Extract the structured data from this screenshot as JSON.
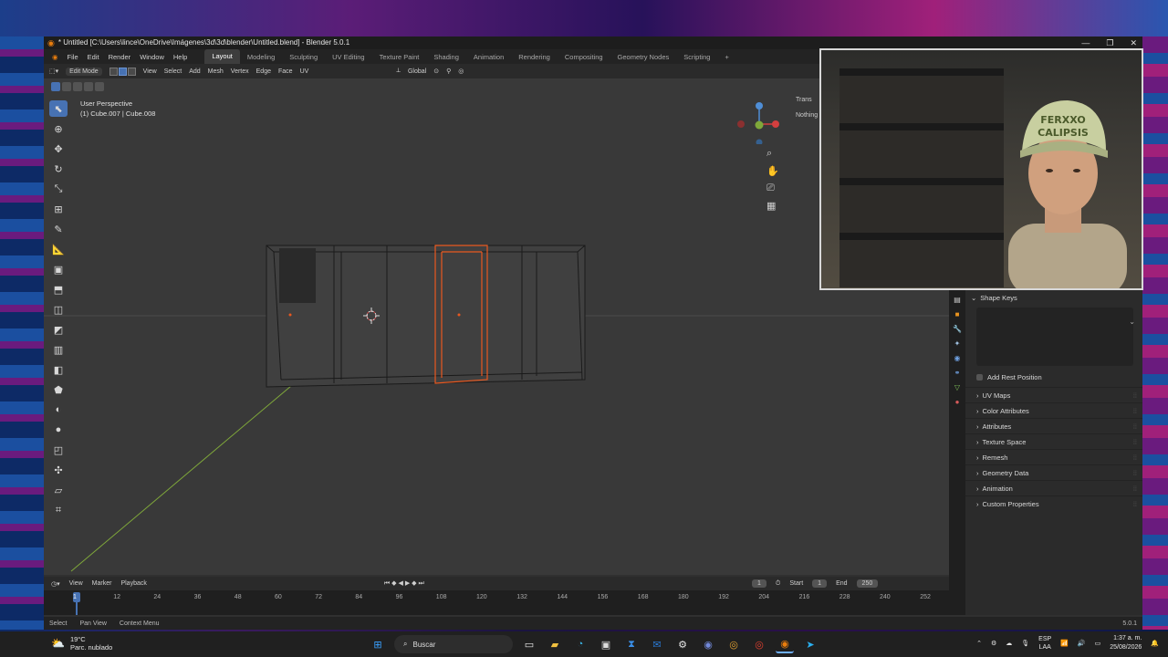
{
  "window": {
    "title": "* Untitled [C:\\Users\\lince\\OneDrive\\Imágenes\\3d\\3d\\blender\\Untitled.blend] - Blender 5.0.1",
    "controls": [
      "—",
      "❐",
      "✕"
    ]
  },
  "menubar": {
    "menus": [
      "File",
      "Edit",
      "Render",
      "Window",
      "Help"
    ],
    "workspaces": [
      "Layout",
      "Modeling",
      "Sculpting",
      "UV Editing",
      "Texture Paint",
      "Shading",
      "Animation",
      "Rendering",
      "Compositing",
      "Geometry Nodes",
      "Scripting"
    ],
    "active_workspace": "Layout",
    "add_workspace": "+"
  },
  "header3d": {
    "mode": "Edit Mode",
    "menus": [
      "View",
      "Select",
      "Add",
      "Mesh",
      "Vertex",
      "Edge",
      "Face",
      "UV"
    ],
    "orientation": "Global"
  },
  "viewport": {
    "view_name": "User Perspective",
    "object_info": "(1) Cube.007 | Cube.008",
    "npanel_tab": "Trans",
    "npanel_text": "Nothing"
  },
  "timeline": {
    "menus": [
      "View",
      "Marker",
      "Playback"
    ],
    "current_frame": "1",
    "start_label": "Start",
    "start": "1",
    "end_label": "End",
    "end": "250",
    "ruler": [
      "1",
      "12",
      "24",
      "36",
      "48",
      "60",
      "72",
      "84",
      "96",
      "108",
      "120",
      "132",
      "144",
      "156",
      "168",
      "180",
      "192",
      "204",
      "216",
      "228",
      "240",
      "252"
    ]
  },
  "statusbar": {
    "items": [
      "Select",
      "Pan View",
      "Context Menu"
    ],
    "version": "5.0.1"
  },
  "properties": {
    "shape_keys": "Shape Keys",
    "add_rest": "Add Rest Position",
    "panels": [
      "UV Maps",
      "Color Attributes",
      "Attributes",
      "Texture Space",
      "Remesh",
      "Geometry Data",
      "Animation",
      "Custom Properties"
    ]
  },
  "webcam": {
    "cap_text_line1": "FERXXO",
    "cap_text_line2": "CALIPSIS"
  },
  "taskbar": {
    "temperature": "19°C",
    "weather": "Parc. nublado",
    "search_placeholder": "Buscar",
    "lang_line1": "ESP",
    "lang_line2": "LAA",
    "time": "1:37 a. m.",
    "date": "25/08/2026"
  },
  "colors": {
    "accent": "#4772b3",
    "selection": "#e8581f",
    "axis_green": "#7fa83a",
    "blender_orange": "#e87d0d"
  }
}
